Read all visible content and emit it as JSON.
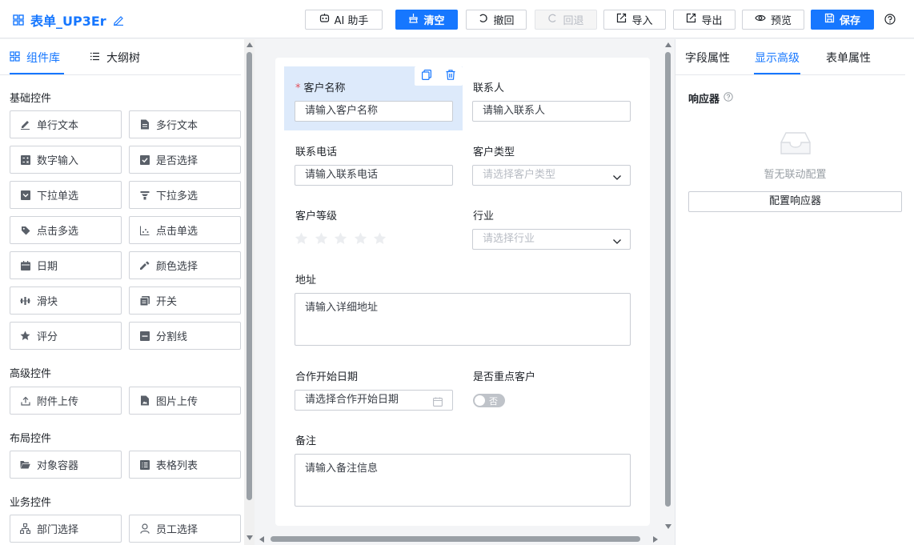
{
  "header": {
    "title": "表单_UP3Er",
    "buttons": {
      "ai": "AI 助手",
      "clear": "清空",
      "undo": "撤回",
      "redo": "回退",
      "import": "导入",
      "export": "导出",
      "preview": "预览",
      "save": "保存"
    }
  },
  "left": {
    "tabs": {
      "library": "组件库",
      "outline": "大纲树"
    },
    "groups": {
      "basic": "基础控件",
      "advanced": "高级控件",
      "layout": "布局控件",
      "business": "业务控件"
    },
    "items": [
      "单行文本",
      "多行文本",
      "数字输入",
      "是否选择",
      "下拉单选",
      "下拉多选",
      "点击多选",
      "点击单选",
      "日期",
      "颜色选择",
      "滑块",
      "开关",
      "评分",
      "分割线",
      "附件上传",
      "图片上传",
      "对象容器",
      "表格列表",
      "部门选择",
      "员工选择"
    ]
  },
  "form": {
    "customer_name": {
      "label": "客户名称",
      "placeholder": "请输入客户名称"
    },
    "contact": {
      "label": "联系人",
      "placeholder": "请输入联系人"
    },
    "phone": {
      "label": "联系电话",
      "placeholder": "请输入联系电话"
    },
    "customer_type": {
      "label": "客户类型",
      "placeholder": "请选择客户类型"
    },
    "level": {
      "label": "客户等级",
      "rating": 0,
      "max": 5
    },
    "industry": {
      "label": "行业",
      "placeholder": "请选择行业"
    },
    "address": {
      "label": "地址",
      "placeholder": "请输入详细地址"
    },
    "start_date": {
      "label": "合作开始日期",
      "placeholder": "请选择合作开始日期"
    },
    "key_customer": {
      "label": "是否重点客户",
      "switch_text": "否",
      "on": false
    },
    "remark": {
      "label": "备注",
      "placeholder": "请输入备注信息"
    }
  },
  "right": {
    "tabs": {
      "field": "字段属性",
      "display": "显示高级",
      "form": "表单属性"
    },
    "responder_title": "响应器",
    "empty_text": "暂无联动配置",
    "config_button": "配置响应器"
  },
  "colors": {
    "primary": "#1677ff",
    "selected_bg": "#ddeafb",
    "required": "#e34d59"
  }
}
